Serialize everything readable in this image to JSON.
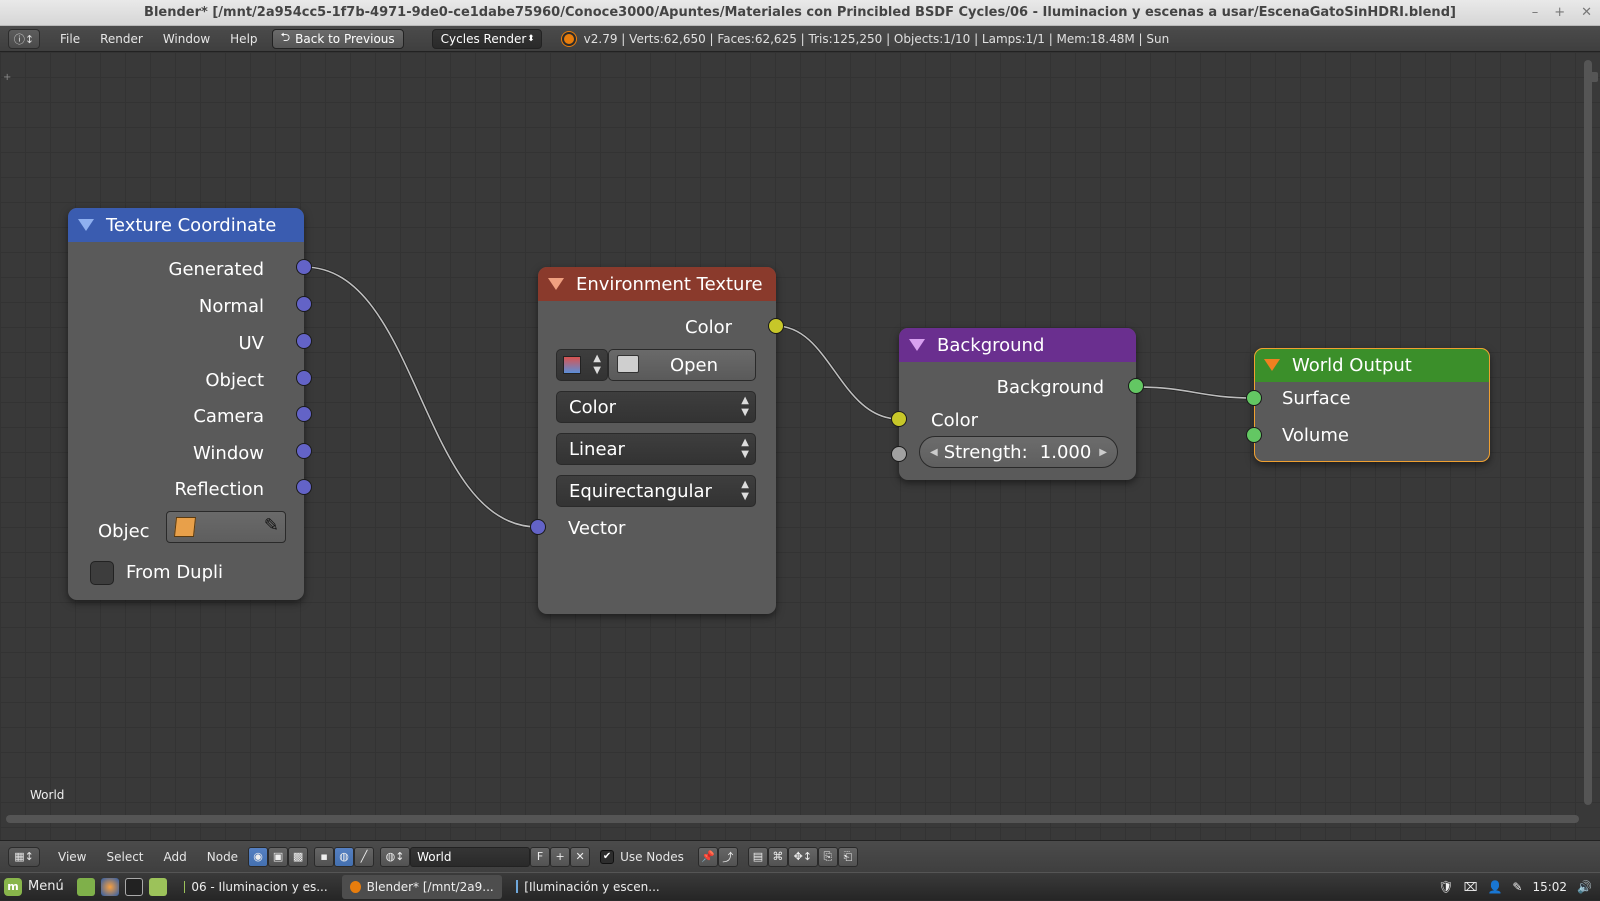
{
  "window": {
    "title": "Blender* [/mnt/2a954cc5-1f7b-4971-9de0-ce1dabe75960/Conoce3000/Apuntes/Materiales con Princibled BSDF Cycles/06 - Iluminacion y escenas a usar/EscenaGatoSinHDRI.blend]",
    "controls": [
      "–",
      "+",
      "✕"
    ]
  },
  "infobar": {
    "menus": [
      "File",
      "Render",
      "Window",
      "Help"
    ],
    "back_button": "Back to Previous",
    "render_engine": "Cycles Render",
    "stats": "v2.79 | Verts:62,650 | Faces:62,625 | Tris:125,250 | Objects:1/10 | Lamps:1/1 | Mem:18.48M | Sun"
  },
  "editor": {
    "context_label": "World"
  },
  "nodes": {
    "texture_coordinate": {
      "title": "Texture Coordinate",
      "header_color": "#3a5cb0",
      "outputs": [
        "Generated",
        "Normal",
        "UV",
        "Object",
        "Camera",
        "Window",
        "Reflection"
      ],
      "object_label": "Objec",
      "from_dupli_label": "From Dupli"
    },
    "environment_texture": {
      "title": "Environment Texture",
      "header_color": "#8a3a2c",
      "output_color": "Color",
      "open_button": "Open",
      "color_mode": "Color",
      "interpolation": "Linear",
      "projection": "Equirectangular",
      "input_vector": "Vector"
    },
    "background": {
      "title": "Background",
      "header_color": "#6a2f8f",
      "output": "Background",
      "input_color": "Color",
      "strength_label": "Strength:",
      "strength_value": "1.000"
    },
    "world_output": {
      "title": "World Output",
      "header_color": "#3b8f2a",
      "inputs": [
        "Surface",
        "Volume"
      ]
    }
  },
  "nodebar": {
    "menus": [
      "View",
      "Select",
      "Add",
      "Node"
    ],
    "datablock": "World",
    "fake_user": "F",
    "use_nodes_label": "Use Nodes"
  },
  "taskbar": {
    "start_label": "Menú",
    "tasks": [
      "06 - Iluminacion y es...",
      "Blender* [/mnt/2a9...",
      "[Iluminación y escen..."
    ],
    "clock": "15:02"
  },
  "colors": {
    "socket_vector": "#6363c7",
    "socket_color": "#c7c729",
    "socket_shader": "#63c763",
    "socket_value": "#a1a1a1",
    "active_node_outline": "#f0a030"
  }
}
